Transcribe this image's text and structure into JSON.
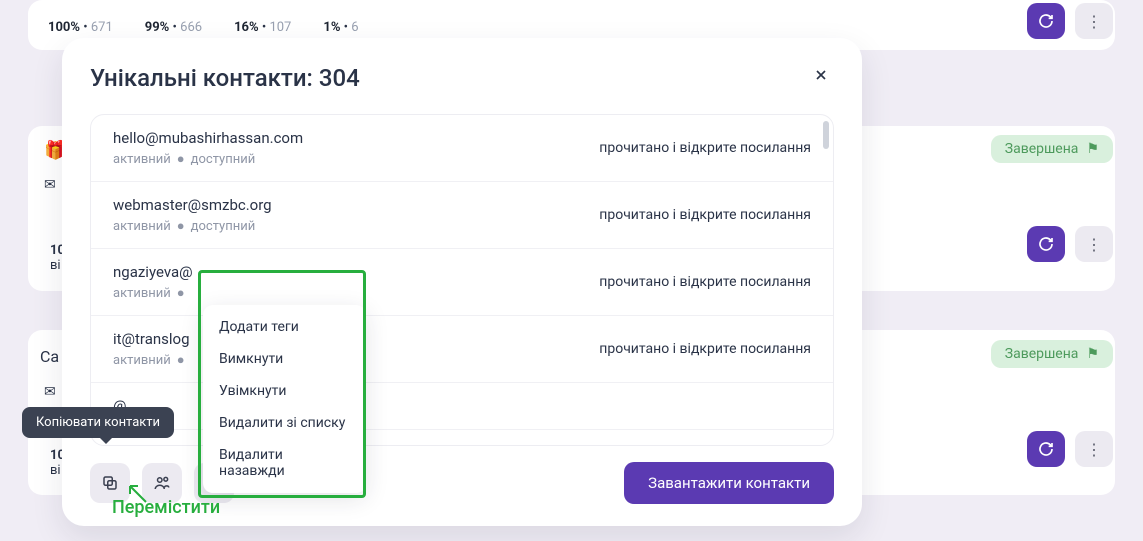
{
  "bg": {
    "stats": [
      {
        "pct": "100%",
        "count": "671"
      },
      {
        "pct": "99%",
        "count": "666"
      },
      {
        "pct": "16%",
        "count": "107"
      },
      {
        "pct": "1%",
        "count": "6"
      }
    ],
    "partial_10": "10",
    "partial_vi": "ві",
    "partial_ca": "Ca",
    "badge_label": "Завершена"
  },
  "modal": {
    "title": "Унікальні контакти: 304",
    "download_label": "Завантажити контакти"
  },
  "contacts": [
    {
      "email": "hello@mubashirhassan.com",
      "active": "активний",
      "available": "доступний",
      "result": "прочитано і відкрите посилання"
    },
    {
      "email": "webmaster@smzbc.org",
      "active": "активний",
      "available": "доступний",
      "result": "прочитано і відкрите посилання"
    },
    {
      "email": "ngaziyeva@",
      "active": "активний",
      "available": "",
      "result": "прочитано і відкрите посилання"
    },
    {
      "email": "it@translog",
      "active": "активний",
      "available": "",
      "result": "прочитано і відкрите посилання"
    },
    {
      "email": "@",
      "active": "",
      "available": "",
      "result": ""
    }
  ],
  "dropdown": [
    "Додати теги",
    "Вимкнути",
    "Увімкнути",
    "Видалити зі списку",
    "Видалити назавжди"
  ],
  "tooltip": "Копіювати контакти",
  "annotation_label": "Перемістити"
}
